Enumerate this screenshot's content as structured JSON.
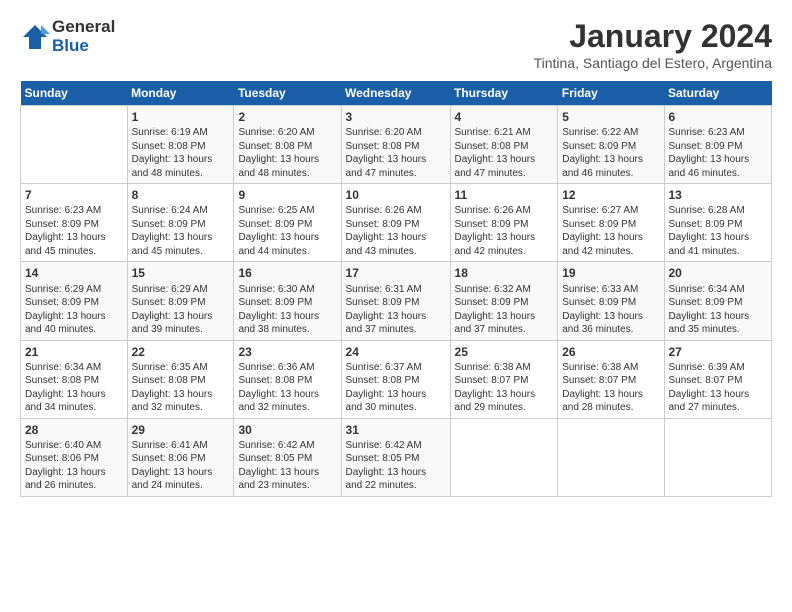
{
  "header": {
    "logo_line1": "General",
    "logo_line2": "Blue",
    "month": "January 2024",
    "location": "Tintina, Santiago del Estero, Argentina"
  },
  "weekdays": [
    "Sunday",
    "Monday",
    "Tuesday",
    "Wednesday",
    "Thursday",
    "Friday",
    "Saturday"
  ],
  "weeks": [
    [
      {
        "day": "",
        "content": ""
      },
      {
        "day": "1",
        "content": "Sunrise: 6:19 AM\nSunset: 8:08 PM\nDaylight: 13 hours\nand 48 minutes."
      },
      {
        "day": "2",
        "content": "Sunrise: 6:20 AM\nSunset: 8:08 PM\nDaylight: 13 hours\nand 48 minutes."
      },
      {
        "day": "3",
        "content": "Sunrise: 6:20 AM\nSunset: 8:08 PM\nDaylight: 13 hours\nand 47 minutes."
      },
      {
        "day": "4",
        "content": "Sunrise: 6:21 AM\nSunset: 8:08 PM\nDaylight: 13 hours\nand 47 minutes."
      },
      {
        "day": "5",
        "content": "Sunrise: 6:22 AM\nSunset: 8:09 PM\nDaylight: 13 hours\nand 46 minutes."
      },
      {
        "day": "6",
        "content": "Sunrise: 6:23 AM\nSunset: 8:09 PM\nDaylight: 13 hours\nand 46 minutes."
      }
    ],
    [
      {
        "day": "7",
        "content": "Sunrise: 6:23 AM\nSunset: 8:09 PM\nDaylight: 13 hours\nand 45 minutes."
      },
      {
        "day": "8",
        "content": "Sunrise: 6:24 AM\nSunset: 8:09 PM\nDaylight: 13 hours\nand 45 minutes."
      },
      {
        "day": "9",
        "content": "Sunrise: 6:25 AM\nSunset: 8:09 PM\nDaylight: 13 hours\nand 44 minutes."
      },
      {
        "day": "10",
        "content": "Sunrise: 6:26 AM\nSunset: 8:09 PM\nDaylight: 13 hours\nand 43 minutes."
      },
      {
        "day": "11",
        "content": "Sunrise: 6:26 AM\nSunset: 8:09 PM\nDaylight: 13 hours\nand 42 minutes."
      },
      {
        "day": "12",
        "content": "Sunrise: 6:27 AM\nSunset: 8:09 PM\nDaylight: 13 hours\nand 42 minutes."
      },
      {
        "day": "13",
        "content": "Sunrise: 6:28 AM\nSunset: 8:09 PM\nDaylight: 13 hours\nand 41 minutes."
      }
    ],
    [
      {
        "day": "14",
        "content": "Sunrise: 6:29 AM\nSunset: 8:09 PM\nDaylight: 13 hours\nand 40 minutes."
      },
      {
        "day": "15",
        "content": "Sunrise: 6:29 AM\nSunset: 8:09 PM\nDaylight: 13 hours\nand 39 minutes."
      },
      {
        "day": "16",
        "content": "Sunrise: 6:30 AM\nSunset: 8:09 PM\nDaylight: 13 hours\nand 38 minutes."
      },
      {
        "day": "17",
        "content": "Sunrise: 6:31 AM\nSunset: 8:09 PM\nDaylight: 13 hours\nand 37 minutes."
      },
      {
        "day": "18",
        "content": "Sunrise: 6:32 AM\nSunset: 8:09 PM\nDaylight: 13 hours\nand 37 minutes."
      },
      {
        "day": "19",
        "content": "Sunrise: 6:33 AM\nSunset: 8:09 PM\nDaylight: 13 hours\nand 36 minutes."
      },
      {
        "day": "20",
        "content": "Sunrise: 6:34 AM\nSunset: 8:09 PM\nDaylight: 13 hours\nand 35 minutes."
      }
    ],
    [
      {
        "day": "21",
        "content": "Sunrise: 6:34 AM\nSunset: 8:08 PM\nDaylight: 13 hours\nand 34 minutes."
      },
      {
        "day": "22",
        "content": "Sunrise: 6:35 AM\nSunset: 8:08 PM\nDaylight: 13 hours\nand 32 minutes."
      },
      {
        "day": "23",
        "content": "Sunrise: 6:36 AM\nSunset: 8:08 PM\nDaylight: 13 hours\nand 32 minutes."
      },
      {
        "day": "24",
        "content": "Sunrise: 6:37 AM\nSunset: 8:08 PM\nDaylight: 13 hours\nand 30 minutes."
      },
      {
        "day": "25",
        "content": "Sunrise: 6:38 AM\nSunset: 8:07 PM\nDaylight: 13 hours\nand 29 minutes."
      },
      {
        "day": "26",
        "content": "Sunrise: 6:38 AM\nSunset: 8:07 PM\nDaylight: 13 hours\nand 28 minutes."
      },
      {
        "day": "27",
        "content": "Sunrise: 6:39 AM\nSunset: 8:07 PM\nDaylight: 13 hours\nand 27 minutes."
      }
    ],
    [
      {
        "day": "28",
        "content": "Sunrise: 6:40 AM\nSunset: 8:06 PM\nDaylight: 13 hours\nand 26 minutes."
      },
      {
        "day": "29",
        "content": "Sunrise: 6:41 AM\nSunset: 8:06 PM\nDaylight: 13 hours\nand 24 minutes."
      },
      {
        "day": "30",
        "content": "Sunrise: 6:42 AM\nSunset: 8:05 PM\nDaylight: 13 hours\nand 23 minutes."
      },
      {
        "day": "31",
        "content": "Sunrise: 6:42 AM\nSunset: 8:05 PM\nDaylight: 13 hours\nand 22 minutes."
      },
      {
        "day": "",
        "content": ""
      },
      {
        "day": "",
        "content": ""
      },
      {
        "day": "",
        "content": ""
      }
    ]
  ]
}
